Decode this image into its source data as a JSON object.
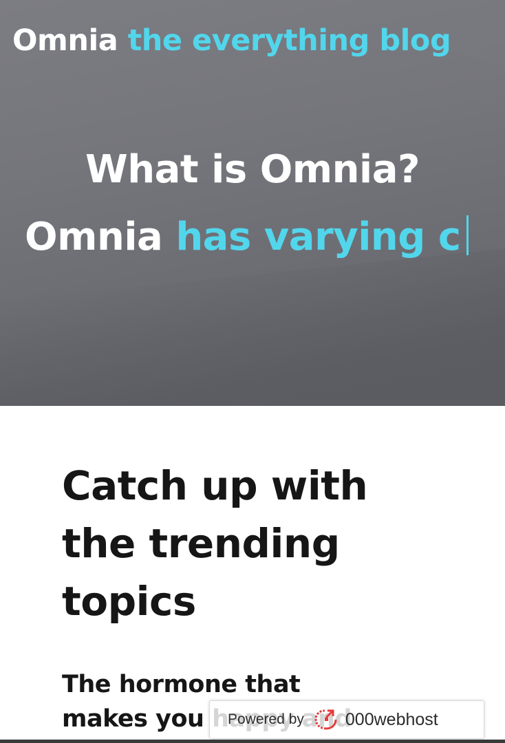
{
  "header": {
    "brand_primary": "Omnia",
    "brand_secondary": "the everything blog"
  },
  "hero": {
    "title": "What is Omnia?",
    "typing_lead": "Omnia",
    "typing_text": "has varying c"
  },
  "main": {
    "section_heading": "Catch up with the trending topics",
    "article_title": "The hormone that makes you happy and"
  },
  "footer_badge": {
    "powered_label": "Powered by",
    "host_name": "000webhost",
    "icon": "webhost-logo-icon"
  },
  "colors": {
    "accent": "#52d6ec",
    "hero_background": "#76777d",
    "text_dark": "#161616",
    "badge_icon": "#e63a3a"
  }
}
